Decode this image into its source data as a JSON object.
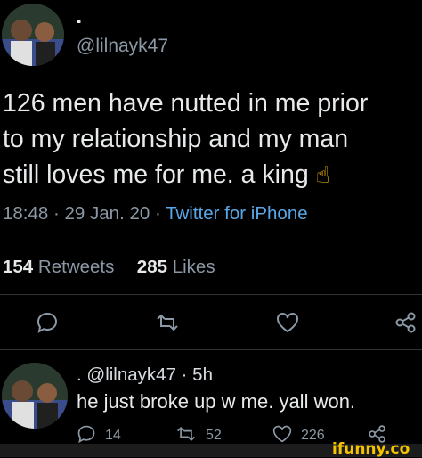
{
  "tweet": {
    "author_name": ".",
    "handle": "@lilnayk47",
    "text_lines": [
      "126 men have nutted in me prior",
      "to my relationship and my man",
      "still loves me for me. a king"
    ],
    "emoji": "☝",
    "time": "18:48 · 29 Jan. 20 · ",
    "client": "Twitter for iPhone",
    "retweets_count": "154",
    "retweets_label": "Retweets",
    "likes_count": "285",
    "likes_label": "Likes"
  },
  "reply": {
    "header": ". @lilnayk47 · 5h",
    "text": "he just broke up w me. yall won.",
    "reply_count": "14",
    "retweet_count": "52",
    "like_count": "226"
  },
  "watermark": "ifunny.co",
  "icons": {
    "reply": "speech-bubble-icon",
    "retweet": "retweet-icon",
    "like": "heart-icon",
    "share": "share-icon"
  },
  "colors": {
    "background": "#000000",
    "text": "#e7e9ea",
    "muted": "#8b98a5",
    "link": "#5aa7e8",
    "watermark": "#f5c400"
  }
}
